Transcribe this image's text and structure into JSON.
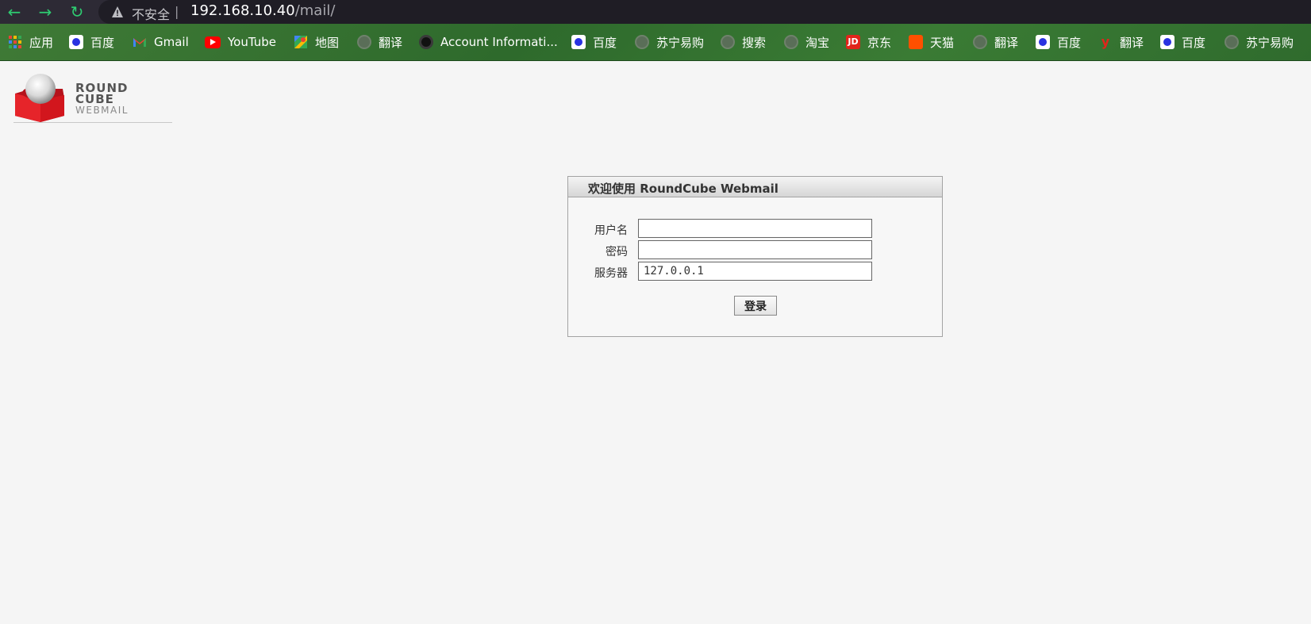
{
  "browser": {
    "insecure_label": "不安全",
    "url_host": "192.168.10.40",
    "url_path": "/mail/",
    "separator": "|"
  },
  "bookmarks": [
    {
      "label": "应用",
      "icon": "apps-grid-icon"
    },
    {
      "label": "百度",
      "icon": "baidu-icon"
    },
    {
      "label": "Gmail",
      "icon": "gmail-icon"
    },
    {
      "label": "YouTube",
      "icon": "youtube-icon"
    },
    {
      "label": "地图",
      "icon": "maps-icon"
    },
    {
      "label": "翻译",
      "icon": "globe-icon"
    },
    {
      "label": "Account Informati...",
      "icon": "account-icon"
    },
    {
      "label": "百度",
      "icon": "baidu-icon"
    },
    {
      "label": "苏宁易购",
      "icon": "globe-icon"
    },
    {
      "label": "搜索",
      "icon": "globe-icon"
    },
    {
      "label": "淘宝",
      "icon": "globe-icon"
    },
    {
      "label": "京东",
      "icon": "jd-icon"
    },
    {
      "label": "天猫",
      "icon": "tmall-icon"
    },
    {
      "label": "翻译",
      "icon": "globe-icon"
    },
    {
      "label": "百度",
      "icon": "baidu-icon"
    },
    {
      "label": "翻译",
      "icon": "youdao-icon"
    },
    {
      "label": "百度",
      "icon": "baidu-icon"
    },
    {
      "label": "苏宁易购",
      "icon": "globe-icon"
    }
  ],
  "logo": {
    "line1": "ROUND",
    "line2": "CUBE",
    "line3": "WEBMAIL"
  },
  "login": {
    "title": "欢迎使用 RoundCube Webmail",
    "username_label": "用户名",
    "username_value": "",
    "password_label": "密码",
    "password_value": "",
    "server_label": "服务器",
    "server_value": "127.0.0.1",
    "submit_label": "登录"
  },
  "colors": {
    "topbar": "#2d2a35",
    "nav_accent": "#2ecc71",
    "bookmarks_bg": "#3a7b34",
    "page_bg": "#f5f5f5",
    "logo_red": "#d2161d"
  }
}
